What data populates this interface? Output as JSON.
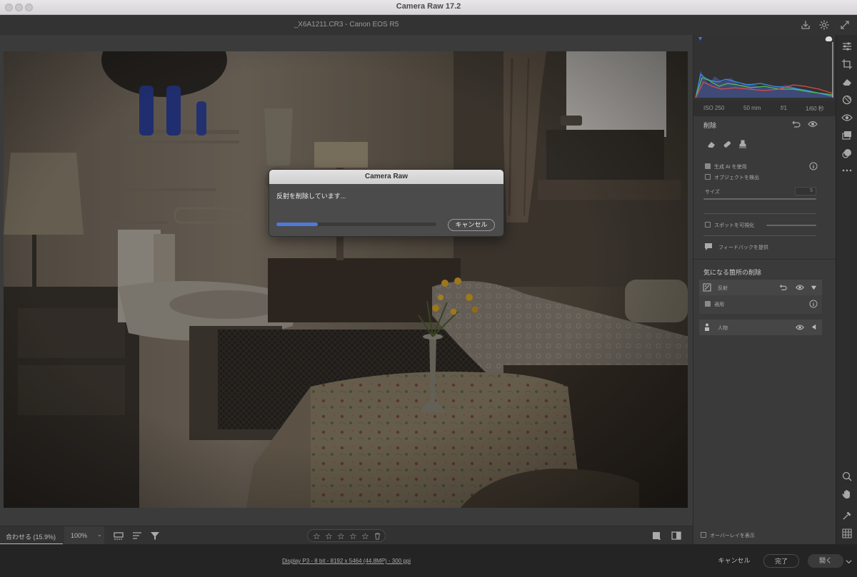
{
  "window": {
    "title": "Camera Raw 17.2"
  },
  "file_bar": {
    "filename": "_X6A1211.CR3  -  Canon EOS R5"
  },
  "dialog": {
    "title": "Camera Raw",
    "message": "反射を削除しています...",
    "progress": 0.26,
    "cancel_label": "キャンセル"
  },
  "histogram": {
    "iso": "ISO 250",
    "focal": "50 mm",
    "aperture": "f/1",
    "shutter": "1/60 秒"
  },
  "remove_panel": {
    "title": "削除",
    "use_gen_ai": "生成 AI を使用",
    "detect_objects": "オブジェクトを検出",
    "size_label": "サイズ",
    "size_value": "5",
    "visualize_spots": "スポットを可視化",
    "feedback": "フィードバックを提供"
  },
  "distraction": {
    "title": "気になる箇所の削除",
    "reflections_label": "反射",
    "apply_label": "適用",
    "people_label": "人物"
  },
  "view_bar": {
    "fit": "合わせる (15.9%)",
    "zoom": "100%",
    "zoom_caret": "⌄"
  },
  "rating": {
    "stars": [
      "☆",
      "☆",
      "☆",
      "☆",
      "☆"
    ],
    "filled": 0
  },
  "status": {
    "image_info": "Display P3 - 8 bit - 8192 x 5464 (44.8MP) - 300 ppi",
    "cancel_label": "キャンセル",
    "done_label": "完了",
    "open_label": "開く",
    "overlay_label": "オーバーレイを表示"
  },
  "colors": {
    "accent": "#4f79d9",
    "background": "#1e1e1e",
    "panel": "#3a3a3a"
  }
}
